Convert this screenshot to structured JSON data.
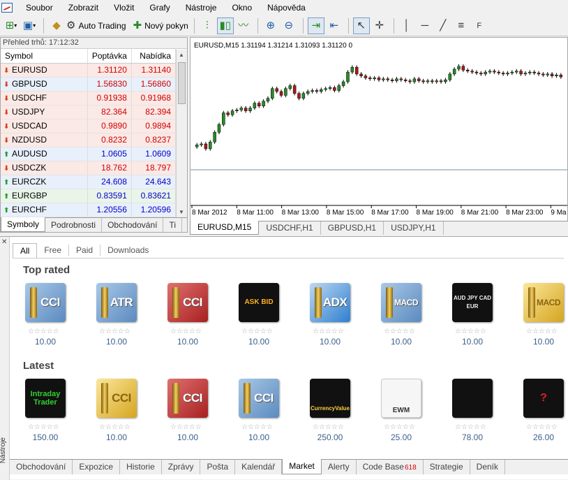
{
  "menubar": {
    "items": [
      "Soubor",
      "Zobrazit",
      "Vložit",
      "Grafy",
      "Nástroje",
      "Okno",
      "Nápověda"
    ]
  },
  "toolbar": {
    "auto_trading_label": "Auto Trading",
    "new_order_label": "Nový pokyn"
  },
  "market_watch": {
    "title": "Přehled trhů: 17:12:32",
    "columns": [
      "Symbol",
      "Poptávka",
      "Nabídka"
    ],
    "rows": [
      {
        "symbol": "EURUSD",
        "bid": "1.31120",
        "ask": "1.31140",
        "dir": "down"
      },
      {
        "symbol": "GBPUSD",
        "bid": "1.56830",
        "ask": "1.56860",
        "dir": "down"
      },
      {
        "symbol": "USDCHF",
        "bid": "0.91938",
        "ask": "0.91968",
        "dir": "down"
      },
      {
        "symbol": "USDJPY",
        "bid": "82.364",
        "ask": "82.394",
        "dir": "down"
      },
      {
        "symbol": "USDCAD",
        "bid": "0.9890",
        "ask": "0.9894",
        "dir": "down"
      },
      {
        "symbol": "NZDUSD",
        "bid": "0.8232",
        "ask": "0.8237",
        "dir": "down"
      },
      {
        "symbol": "AUDUSD",
        "bid": "1.0605",
        "ask": "1.0609",
        "dir": "up"
      },
      {
        "symbol": "USDCZK",
        "bid": "18.762",
        "ask": "18.797",
        "dir": "down"
      },
      {
        "symbol": "EURCZK",
        "bid": "24.608",
        "ask": "24.643",
        "dir": "up"
      },
      {
        "symbol": "EURGBP",
        "bid": "0.83591",
        "ask": "0.83621",
        "dir": "up"
      },
      {
        "symbol": "EURCHF",
        "bid": "1.20556",
        "ask": "1.20596",
        "dir": "up"
      }
    ],
    "tabs": [
      "Symboly",
      "Podrobnosti",
      "Obchodování",
      "Ti"
    ]
  },
  "chart": {
    "header": "EURUSD,M15  1.31194 1.31214 1.31093 1.31120  0",
    "time_labels": [
      "8 Mar 2012",
      "8 Mar 11:00",
      "8 Mar 13:00",
      "8 Mar 15:00",
      "8 Mar 17:00",
      "8 Mar 19:00",
      "8 Mar 21:00",
      "8 Mar 23:00",
      "9 Ma"
    ],
    "tabs": [
      "EURUSD,M15",
      "USDCHF,H1",
      "GBPUSD,H1",
      "USDJPY,H1"
    ],
    "bull_color": "#2a8a2a",
    "bear_color": "#b01818"
  },
  "chart_data": {
    "type": "candlestick",
    "title": "EURUSD,M15",
    "ohlc_readout": [
      "1.31194",
      "1.31214",
      "1.31093",
      "1.31120"
    ],
    "x_labels": [
      "8 Mar 2012",
      "8 Mar 11:00",
      "8 Mar 13:00",
      "8 Mar 15:00",
      "8 Mar 17:00",
      "8 Mar 19:00",
      "8 Mar 21:00",
      "8 Mar 23:00",
      "9 Ma"
    ],
    "series": [
      {
        "values": [
          0.17,
          0.18,
          0.13,
          0.2,
          0.3,
          0.38,
          0.5,
          0.48,
          0.52,
          0.53,
          0.55,
          0.52,
          0.55,
          0.6,
          0.57,
          0.62,
          0.65,
          0.75,
          0.72,
          0.68,
          0.75,
          0.78,
          0.7,
          0.65,
          0.7,
          0.72,
          0.73,
          0.72,
          0.74,
          0.75,
          0.76,
          0.73,
          0.78,
          0.82,
          0.92,
          0.97,
          0.9,
          0.88,
          0.86,
          0.85,
          0.86,
          0.84,
          0.85,
          0.84,
          0.83,
          0.85,
          0.84,
          0.83,
          0.82,
          0.85,
          0.83,
          0.82,
          0.83,
          0.82,
          0.83,
          0.82,
          0.84,
          0.9,
          0.95,
          0.98,
          0.94,
          0.93,
          0.92,
          0.91,
          0.9,
          0.92,
          0.93,
          0.92,
          0.91,
          0.9,
          0.91,
          0.92,
          0.93,
          0.9,
          0.91,
          0.92,
          0.91,
          0.9,
          0.89,
          0.9,
          0.88,
          0.89,
          0.87
        ]
      }
    ]
  },
  "market": {
    "filters": [
      "All",
      "Free",
      "Paid",
      "Downloads"
    ],
    "sections": [
      {
        "title": "Top rated",
        "products": [
          {
            "name": "CCI",
            "price": "10.00",
            "style": "blue"
          },
          {
            "name": "ATR",
            "price": "10.00",
            "style": "blue"
          },
          {
            "name": "CCI",
            "price": "10.00",
            "style": "red"
          },
          {
            "name": "ASK BID",
            "price": "10.00",
            "style": "black-ask"
          },
          {
            "name": "ADX",
            "price": "10.00",
            "style": "lightblue"
          },
          {
            "name": "MACD",
            "price": "10.00",
            "style": "blue"
          },
          {
            "name": "AUD JPY CAD EUR",
            "price": "10.00",
            "style": "black-cur"
          },
          {
            "name": "MACD",
            "price": "10.00",
            "style": "yellow"
          }
        ]
      },
      {
        "title": "Latest",
        "products": [
          {
            "name": "Intraday Trader",
            "price": "150.00",
            "style": "black-intraday"
          },
          {
            "name": "CCI",
            "price": "10.00",
            "style": "yellow"
          },
          {
            "name": "CCI",
            "price": "10.00",
            "style": "red"
          },
          {
            "name": "CCI",
            "price": "10.00",
            "style": "blue"
          },
          {
            "name": "CurrencyValue",
            "price": "250.00",
            "style": "black-cv"
          },
          {
            "name": "EWM",
            "price": "25.00",
            "style": "white-ewm"
          },
          {
            "name": "",
            "price": "78.00",
            "style": "black-dots"
          },
          {
            "name": "?",
            "price": "26.00",
            "style": "black-q"
          }
        ]
      }
    ],
    "side_label": "Nástroje",
    "bottom_tabs": [
      {
        "label": "Obchodování"
      },
      {
        "label": "Expozice"
      },
      {
        "label": "Historie"
      },
      {
        "label": "Zprávy"
      },
      {
        "label": "Pošta"
      },
      {
        "label": "Kalendář"
      },
      {
        "label": "Market",
        "active": true
      },
      {
        "label": "Alerty"
      },
      {
        "label": "Code Base",
        "badge": "618"
      },
      {
        "label": "Strategie"
      },
      {
        "label": "Deník"
      }
    ]
  }
}
